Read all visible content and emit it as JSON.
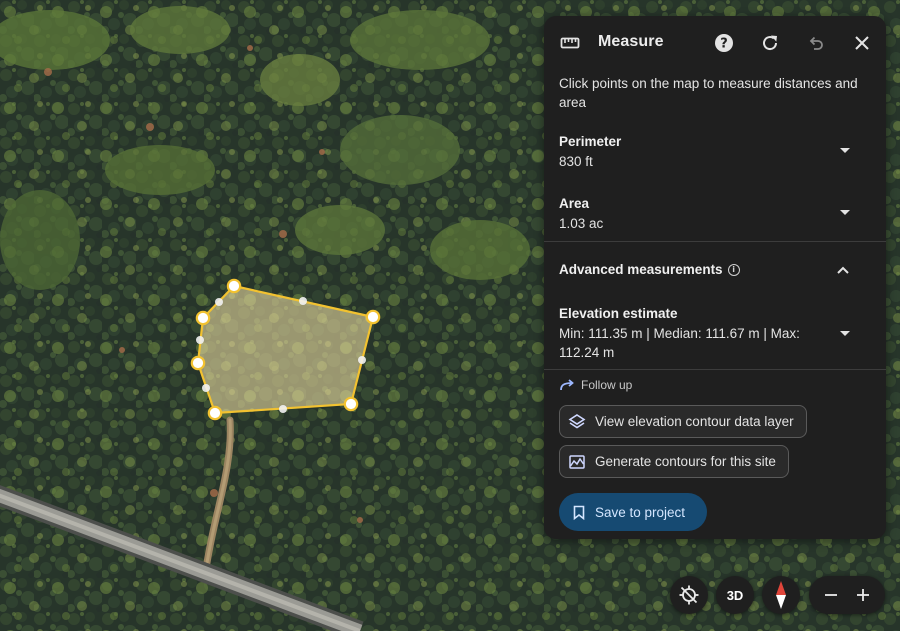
{
  "panel": {
    "title": "Measure",
    "icons": {
      "tool": "ruler-icon",
      "help": "help-icon",
      "refresh": "refresh-icon",
      "undo": "undo-icon",
      "close": "close-icon"
    },
    "instructions": "Click points on the map to measure distances and area",
    "perimeter": {
      "label": "Perimeter",
      "value": "830 ft"
    },
    "area": {
      "label": "Area",
      "value": "1.03 ac"
    },
    "advanced": {
      "label": "Advanced measurements",
      "expanded": true
    },
    "elevation": {
      "label": "Elevation estimate",
      "value": "Min: 111.35 m | Median: 111.67 m | Max: 112.24 m"
    },
    "follow_up": {
      "label": "Follow up",
      "actions": [
        {
          "label": "View elevation contour data layer",
          "icon": "layers-icon"
        },
        {
          "label": "Generate contours for this site",
          "icon": "terrain-icon"
        }
      ]
    },
    "save_label": "Save to project"
  },
  "map_controls": {
    "locate_icon": "location-off-icon",
    "view_3d_label": "3D",
    "compass_icon": "compass-icon",
    "zoom_out_icon": "minus-icon",
    "zoom_in_icon": "plus-icon"
  },
  "colors": {
    "panel_bg": "#1f1f1f",
    "polygon_stroke": "#f2c230",
    "polygon_fill": "#e8d8a0",
    "save_button": "#164a72",
    "compass_north": "#e0453a"
  }
}
